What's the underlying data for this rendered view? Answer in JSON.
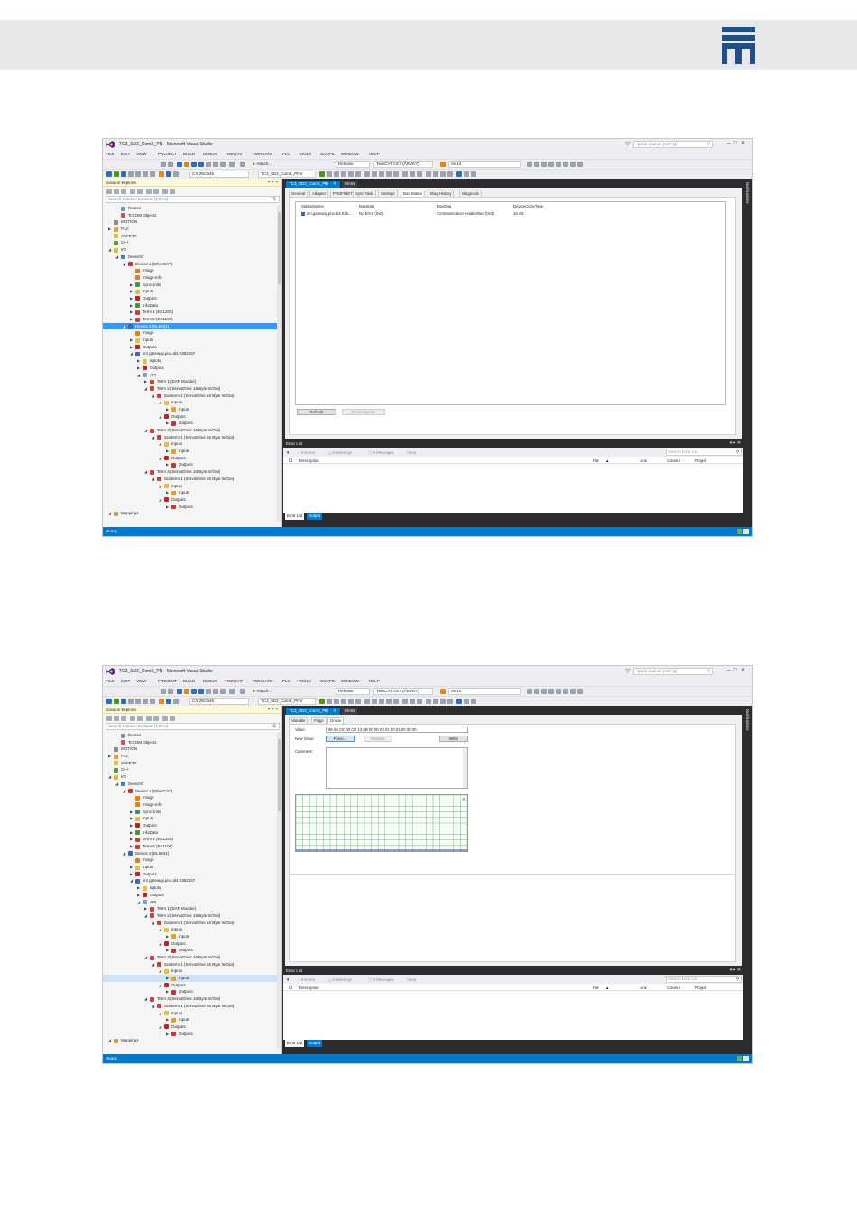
{
  "colors": {
    "brand_blue": "#1f4e8c",
    "vs_accent": "#007acc",
    "selection": "#3399ff",
    "dark_chrome": "#2d2d30",
    "chart_grid": "#56c26a"
  },
  "screens": [
    {
      "window_title": "TC3_SD2_ComX_PN - Microsoft Visual Studio",
      "quick_launch": "Quick Launch (Ctrl+Q)",
      "menu": [
        "FILE",
        "EDIT",
        "VIEW",
        "PROJECT",
        "BUILD",
        "DEBUG",
        "TWINCAT",
        "TWINSAFE",
        "PLC",
        "TOOLS",
        "SCOPE",
        "WINDOW",
        "HELP"
      ],
      "toolbar": {
        "attach": "Attach...",
        "config": "Release",
        "target": "TwinCAT CE7 (ARMV7)",
        "search_target": "rec14",
        "target_system": "CX-2EC546",
        "project": "TC3_SD2_ComX_PNV"
      },
      "solution_explorer": {
        "title": "Solution Explorer",
        "search_placeholder": "Search Solution Explorer (Ctrl+ü)",
        "tree": [
          {
            "label": "Routes",
            "indent": 3,
            "exp": "",
            "icon": "route-icon"
          },
          {
            "label": "TcCOM Objects",
            "indent": 3,
            "exp": "",
            "icon": "tccom-icon"
          },
          {
            "label": "MOTION",
            "indent": 2,
            "exp": "",
            "icon": "motion-icon"
          },
          {
            "label": "PLC",
            "indent": 2,
            "exp": "▶",
            "icon": "plc-icon"
          },
          {
            "label": "SAFETY",
            "indent": 2,
            "exp": "",
            "icon": "safety-icon"
          },
          {
            "label": "C++",
            "indent": 2,
            "exp": "",
            "icon": "cpp-icon"
          },
          {
            "label": "I/O",
            "indent": 2,
            "exp": "◢",
            "icon": "io-icon"
          },
          {
            "label": "Devices",
            "indent": 3,
            "exp": "◢",
            "icon": "devices-icon"
          },
          {
            "label": "Device 1 (EtherCAT)",
            "indent": 4,
            "exp": "◢",
            "icon": "ethercat-icon"
          },
          {
            "label": "Image",
            "indent": 5,
            "exp": "",
            "icon": "image-icon"
          },
          {
            "label": "Image-Info",
            "indent": 5,
            "exp": "",
            "icon": "image-info-icon"
          },
          {
            "label": "SyncUnits",
            "indent": 5,
            "exp": "▶",
            "icon": "syncunits-icon"
          },
          {
            "label": "Inputs",
            "indent": 5,
            "exp": "▶",
            "icon": "inputs-icon"
          },
          {
            "label": "Outputs",
            "indent": 5,
            "exp": "▶",
            "icon": "outputs-icon"
          },
          {
            "label": "InfoData",
            "indent": 5,
            "exp": "▶",
            "icon": "infodata-icon"
          },
          {
            "label": "Term 1 (EK1200)",
            "indent": 5,
            "exp": "▶",
            "icon": "terminal-icon"
          },
          {
            "label": "Term 5 (EK1100)",
            "indent": 5,
            "exp": "▶",
            "icon": "terminal-icon"
          },
          {
            "label": "Device 2 (EL6631)",
            "indent": 4,
            "exp": "◢",
            "icon": "profinet-icon",
            "selected": true
          },
          {
            "label": "Image",
            "indent": 5,
            "exp": "",
            "icon": "image-icon"
          },
          {
            "label": "Inputs",
            "indent": 5,
            "exp": "▶",
            "icon": "inputs-icon"
          },
          {
            "label": "Outputs",
            "indent": 5,
            "exp": "▶",
            "icon": "outputs-icon"
          },
          {
            "label": "sm.gateway.pns.al4.0362157",
            "indent": 5,
            "exp": "◢",
            "icon": "gateway-icon"
          },
          {
            "label": "Inputs",
            "indent": 6,
            "exp": "▶",
            "icon": "inputs-icon"
          },
          {
            "label": "Outputs",
            "indent": 6,
            "exp": "▶",
            "icon": "outputs-icon"
          },
          {
            "label": "API",
            "indent": 6,
            "exp": "◢",
            "icon": "api-icon"
          },
          {
            "label": "Term 1 (DAP Module)",
            "indent": 7,
            "exp": "▶",
            "icon": "terminal-icon"
          },
          {
            "label": "Term 2 (ServoDrive 16 Byte In/Out)",
            "indent": 7,
            "exp": "◢",
            "icon": "terminal-icon"
          },
          {
            "label": "Subterm 1 (ServoDrive 16 Byte In/Out)",
            "indent": 8,
            "exp": "◢",
            "icon": "terminal-icon"
          },
          {
            "label": "Inputs",
            "indent": 9,
            "exp": "◢",
            "icon": "inputs-icon"
          },
          {
            "label": "Inputs",
            "indent": 10,
            "exp": "▶",
            "icon": "inputs-var-icon"
          },
          {
            "label": "Outputs",
            "indent": 9,
            "exp": "◢",
            "icon": "outputs-icon"
          },
          {
            "label": "Outputs",
            "indent": 10,
            "exp": "▶",
            "icon": "outputs-var-icon"
          },
          {
            "label": "Term 3 (ServoDrive 16 Byte In/Out)",
            "indent": 7,
            "exp": "◢",
            "icon": "terminal-icon"
          },
          {
            "label": "Subterm 1 (ServoDrive 16 Byte In/Out)",
            "indent": 8,
            "exp": "◢",
            "icon": "terminal-icon"
          },
          {
            "label": "Inputs",
            "indent": 9,
            "exp": "◢",
            "icon": "inputs-icon"
          },
          {
            "label": "Inputs",
            "indent": 10,
            "exp": "▶",
            "icon": "inputs-var-icon"
          },
          {
            "label": "Outputs",
            "indent": 9,
            "exp": "◢",
            "icon": "outputs-icon"
          },
          {
            "label": "Outputs",
            "indent": 10,
            "exp": "▶",
            "icon": "outputs-var-icon"
          },
          {
            "label": "Term 4 (ServoDrive 16 Byte In/Out)",
            "indent": 7,
            "exp": "◢",
            "icon": "terminal-icon"
          },
          {
            "label": "Subterm 1 (ServoDrive 16 Byte In/Out)",
            "indent": 8,
            "exp": "◢",
            "icon": "terminal-icon"
          },
          {
            "label": "Inputs",
            "indent": 9,
            "exp": "◢",
            "icon": "inputs-icon"
          },
          {
            "label": "Inputs",
            "indent": 10,
            "exp": "▶",
            "icon": "inputs-var-icon"
          },
          {
            "label": "Outputs",
            "indent": 9,
            "exp": "◢",
            "icon": "outputs-icon"
          },
          {
            "label": "Outputs",
            "indent": 10,
            "exp": "▶",
            "icon": "outputs-var-icon"
          },
          {
            "label": "Mappings",
            "indent": 2,
            "exp": "◢",
            "icon": "mappings-icon"
          }
        ]
      },
      "doc_tabs": [
        {
          "label": "TC3_SD2_ComX_PN",
          "active": true,
          "pin": "⊟",
          "close": "✕"
        },
        {
          "label": "MAIN",
          "active": false
        }
      ],
      "editor": {
        "kind": "boxstates",
        "sub_tabs": [
          "General",
          "Adapter",
          "PROFINET",
          "Sync Task",
          "Settings",
          "Box States",
          "Diag History",
          "Diagnosis"
        ],
        "active_sub_tab": 5,
        "table_headers": [
          "StationName",
          "BoxState",
          "BoxDiag",
          "DeviceCycleTime"
        ],
        "rows": [
          [
            "sm.gateway.pns.al4.036...",
            "No Error (0x0)",
            "Communication established (0x2)",
            "16 ms"
          ]
        ],
        "buttons": [
          "Refresh",
          "Reset Counter"
        ]
      },
      "error_list": {
        "title": "Error List",
        "filter": "▼",
        "errors": "0 Errors",
        "warnings": "0 Warnings",
        "messages": "0 Messages",
        "clear": "Clear",
        "search_placeholder": "Search Error List",
        "columns": [
          "Description",
          "File",
          "Line",
          "Column",
          "Project"
        ],
        "bottom_tabs": [
          "Error List",
          "Output"
        ]
      },
      "notifications": "Notifications",
      "status": "Ready"
    },
    {
      "window_title": "TC3_SD2_ComX_PN - Microsoft Visual Studio",
      "quick_launch": "Quick Launch (Ctrl+Q)",
      "menu": [
        "FILE",
        "EDIT",
        "VIEW",
        "PROJECT",
        "BUILD",
        "DEBUG",
        "TWINCAT",
        "TWINSAFE",
        "PLC",
        "TOOLS",
        "SCOPE",
        "WINDOW",
        "HELP"
      ],
      "toolbar": {
        "attach": "Attach...",
        "config": "Release",
        "target": "TwinCAT CE7 (ARMV7)",
        "search_target": "rec14",
        "target_system": "CX-2EC546",
        "project": "TC3_SD2_ComX_PNV"
      },
      "solution_explorer": {
        "title": "Solution Explorer",
        "search_placeholder": "Search Solution Explorer (Ctrl+ü)",
        "tree": [
          {
            "label": "Routes",
            "indent": 3,
            "exp": "",
            "icon": "route-icon"
          },
          {
            "label": "TcCOM Objects",
            "indent": 3,
            "exp": "",
            "icon": "tccom-icon"
          },
          {
            "label": "MOTION",
            "indent": 2,
            "exp": "",
            "icon": "motion-icon"
          },
          {
            "label": "PLC",
            "indent": 2,
            "exp": "▶",
            "icon": "plc-icon"
          },
          {
            "label": "SAFETY",
            "indent": 2,
            "exp": "",
            "icon": "safety-icon"
          },
          {
            "label": "C++",
            "indent": 2,
            "exp": "",
            "icon": "cpp-icon"
          },
          {
            "label": "I/O",
            "indent": 2,
            "exp": "◢",
            "icon": "io-icon"
          },
          {
            "label": "Devices",
            "indent": 3,
            "exp": "◢",
            "icon": "devices-icon"
          },
          {
            "label": "Device 1 (EtherCAT)",
            "indent": 4,
            "exp": "◢",
            "icon": "ethercat-icon"
          },
          {
            "label": "Image",
            "indent": 5,
            "exp": "",
            "icon": "image-icon"
          },
          {
            "label": "Image-Info",
            "indent": 5,
            "exp": "",
            "icon": "image-info-icon"
          },
          {
            "label": "SyncUnits",
            "indent": 5,
            "exp": "▶",
            "icon": "syncunits-icon"
          },
          {
            "label": "Inputs",
            "indent": 5,
            "exp": "▶",
            "icon": "inputs-icon"
          },
          {
            "label": "Outputs",
            "indent": 5,
            "exp": "▶",
            "icon": "outputs-icon"
          },
          {
            "label": "InfoData",
            "indent": 5,
            "exp": "▶",
            "icon": "infodata-icon"
          },
          {
            "label": "Term 1 (EK1200)",
            "indent": 5,
            "exp": "▶",
            "icon": "terminal-icon"
          },
          {
            "label": "Term 5 (EK1100)",
            "indent": 5,
            "exp": "▶",
            "icon": "terminal-icon"
          },
          {
            "label": "Device 2 (EL6631)",
            "indent": 4,
            "exp": "◢",
            "icon": "profinet-icon"
          },
          {
            "label": "Image",
            "indent": 5,
            "exp": "",
            "icon": "image-icon"
          },
          {
            "label": "Inputs",
            "indent": 5,
            "exp": "▶",
            "icon": "inputs-icon"
          },
          {
            "label": "Outputs",
            "indent": 5,
            "exp": "▶",
            "icon": "outputs-icon"
          },
          {
            "label": "sm.gateway.pns.al4.0362157",
            "indent": 5,
            "exp": "◢",
            "icon": "gateway-icon"
          },
          {
            "label": "Inputs",
            "indent": 6,
            "exp": "▶",
            "icon": "inputs-icon"
          },
          {
            "label": "Outputs",
            "indent": 6,
            "exp": "▶",
            "icon": "outputs-icon"
          },
          {
            "label": "API",
            "indent": 6,
            "exp": "◢",
            "icon": "api-icon"
          },
          {
            "label": "Term 1 (DAP Module)",
            "indent": 7,
            "exp": "▶",
            "icon": "terminal-icon"
          },
          {
            "label": "Term 2 (ServoDrive 16 Byte In/Out)",
            "indent": 7,
            "exp": "◢",
            "icon": "terminal-icon"
          },
          {
            "label": "Subterm 1 (ServoDrive 16 Byte In/Out)",
            "indent": 8,
            "exp": "◢",
            "icon": "terminal-icon"
          },
          {
            "label": "Inputs",
            "indent": 9,
            "exp": "◢",
            "icon": "inputs-icon"
          },
          {
            "label": "Inputs",
            "indent": 10,
            "exp": "▶",
            "icon": "inputs-var-icon"
          },
          {
            "label": "Outputs",
            "indent": 9,
            "exp": "◢",
            "icon": "outputs-icon"
          },
          {
            "label": "Outputs",
            "indent": 10,
            "exp": "▶",
            "icon": "outputs-var-icon"
          },
          {
            "label": "Term 3 (ServoDrive 16 Byte In/Out)",
            "indent": 7,
            "exp": "◢",
            "icon": "terminal-icon"
          },
          {
            "label": "Subterm 1 (ServoDrive 16 Byte In/Out)",
            "indent": 8,
            "exp": "◢",
            "icon": "terminal-icon"
          },
          {
            "label": "Inputs",
            "indent": 9,
            "exp": "◢",
            "icon": "inputs-icon"
          },
          {
            "label": "Inputs",
            "indent": 10,
            "exp": "▶",
            "icon": "inputs-var-icon",
            "highlighted": true
          },
          {
            "label": "Outputs",
            "indent": 9,
            "exp": "◢",
            "icon": "outputs-icon"
          },
          {
            "label": "Outputs",
            "indent": 10,
            "exp": "▶",
            "icon": "outputs-var-icon"
          },
          {
            "label": "Term 4 (ServoDrive 16 Byte In/Out)",
            "indent": 7,
            "exp": "◢",
            "icon": "terminal-icon"
          },
          {
            "label": "Subterm 1 (ServoDrive 16 Byte In/Out)",
            "indent": 8,
            "exp": "◢",
            "icon": "terminal-icon"
          },
          {
            "label": "Inputs",
            "indent": 9,
            "exp": "◢",
            "icon": "inputs-icon"
          },
          {
            "label": "Inputs",
            "indent": 10,
            "exp": "▶",
            "icon": "inputs-var-icon"
          },
          {
            "label": "Outputs",
            "indent": 9,
            "exp": "◢",
            "icon": "outputs-icon"
          },
          {
            "label": "Outputs",
            "indent": 10,
            "exp": "▶",
            "icon": "outputs-var-icon"
          },
          {
            "label": "Mappings",
            "indent": 2,
            "exp": "◢",
            "icon": "mappings-icon"
          }
        ]
      },
      "doc_tabs": [
        {
          "label": "TC3_SD2_ComX_PN",
          "active": true,
          "pin": "⊟",
          "close": "✕"
        },
        {
          "label": "MAIN",
          "active": false
        }
      ],
      "editor": {
        "kind": "online",
        "sub_tabs": [
          "Variable",
          "Flags",
          "Online"
        ],
        "active_sub_tab": 2,
        "value_label": "Value:",
        "value": "96 5A CE 00 CE 13 0B 00 00 00 01 00 01 00 00 00",
        "new_value_label": "New Value:",
        "buttons": [
          "Force...",
          "Release",
          "Write"
        ],
        "comment_label": "Comment:",
        "chart_value": "0"
      },
      "error_list": {
        "title": "Error List",
        "filter": "▼",
        "errors": "0 Errors",
        "warnings": "0 Warnings",
        "messages": "0 Messages",
        "clear": "Clear",
        "search_placeholder": "Search Error List",
        "columns": [
          "Description",
          "File",
          "Line",
          "Column",
          "Project"
        ],
        "bottom_tabs": [
          "Error List",
          "Output"
        ]
      },
      "notifications": "Notifications",
      "status": "Ready"
    }
  ]
}
